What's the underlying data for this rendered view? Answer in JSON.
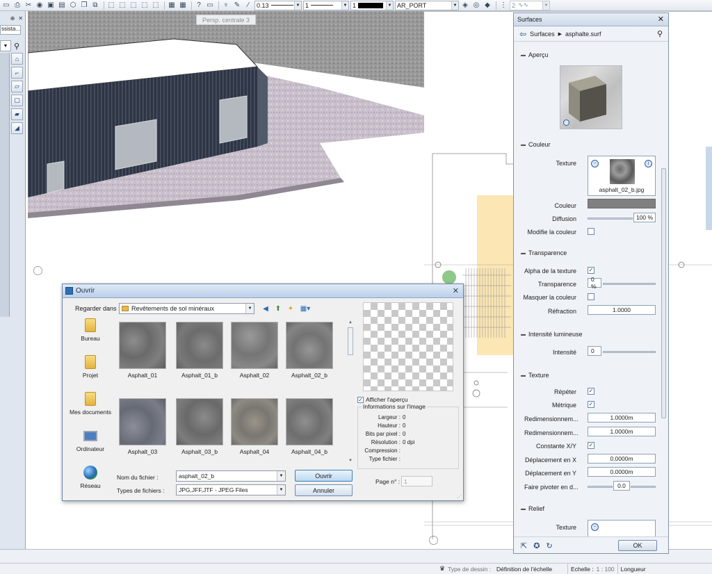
{
  "toolbar": {
    "pen_value": "0.13",
    "line_value": "1",
    "color_value": "1",
    "layer_value": "AR_PORT",
    "zoom_value": "2"
  },
  "left_dock": {
    "pin_glyph": "⊕",
    "close_glyph": "✕",
    "tab_label": "ssista..."
  },
  "viewport": {
    "label": "Persp. centrale 3"
  },
  "colors": {
    "accent": "#3c7fb1",
    "building_wall": "#2e3544",
    "pavement": "#c9c0cc",
    "zone_yellow": "#fbe6b4"
  },
  "dialog": {
    "title": "Ouvrir",
    "look_in_label": "Regarder dans :",
    "folder": "Revêtements de sol minéraux",
    "places": [
      "Bureau",
      "Projet",
      "Mes documents",
      "Ordinateur",
      "Réseau"
    ],
    "files": [
      "Asphalt_01",
      "Asphalt_01_b",
      "Asphalt_02",
      "Asphalt_02_b",
      "Asphalt_03",
      "Asphalt_03_b",
      "Asphalt_04",
      "Asphalt_04_b"
    ],
    "show_preview_label": "Afficher l'aperçu",
    "info_title": "Informations sur l'image",
    "info": [
      {
        "k": "Largeur :",
        "v": "0"
      },
      {
        "k": "Hauteur :",
        "v": "0"
      },
      {
        "k": "Bits par pixel :",
        "v": "0"
      },
      {
        "k": "Résolution :",
        "v": "0 dpi"
      },
      {
        "k": "Compression :",
        "v": ""
      },
      {
        "k": "Type fichier :",
        "v": ""
      }
    ],
    "filename_label": "Nom du fichier :",
    "filename_value": "asphalt_02_b",
    "filetype_label": "Types de fichiers :",
    "filetype_value": "JPG,JFF,JTF - JPEG Files",
    "open_button": "Ouvrir",
    "cancel_button": "Annuler",
    "page_label": "Page n° :",
    "page_value": "1"
  },
  "surfaces": {
    "title": "Surfaces",
    "breadcrumb_root": "Surfaces",
    "breadcrumb_file": "asphalte.surf",
    "sections": {
      "apercu": "Aperçu",
      "couleur": "Couleur",
      "transparence": "Transparence",
      "intensite": "Intensité lumineuse",
      "texture": "Texture",
      "relief": "Relief"
    },
    "texture_label": "Texture",
    "texture_file": "asphalt_02_b.jpg",
    "couleur_label": "Couleur",
    "diffusion_label": "Diffusion",
    "diffusion_value": "100 %",
    "modifie_label": "Modifie la couleur",
    "alpha_label": "Alpha de la texture",
    "transparence_label": "Transparence",
    "transparence_value": "0 %",
    "masquer_label": "Masquer la couleur",
    "refraction_label": "Réfraction",
    "refraction_value": "1.0000",
    "intensite_label": "Intensité",
    "intensite_value": "0",
    "repeter_label": "Répéter",
    "metrique_label": "Métrique",
    "redim1_label": "Redimensionnem...",
    "redim1_value": "1.0000m",
    "redim2_label": "Redimensionnem...",
    "redim2_value": "1.0000m",
    "constante_label": "Constante X/Y",
    "deplx_label": "Déplacement en X",
    "deplx_value": "0.0000m",
    "deply_label": "Déplacement en Y",
    "deply_value": "0.0000m",
    "pivot_label": "Faire pivoter en d...",
    "pivot_value": "0.0",
    "relief_texture_label": "Texture",
    "ok_button": "OK"
  },
  "status": {
    "drawing_type_label": "Type de dessin :",
    "drawing_type_value": "Définition de l'échelle",
    "scale_label": "Echelle :",
    "scale_value": "1 : 100",
    "length_label": "Longueur"
  }
}
